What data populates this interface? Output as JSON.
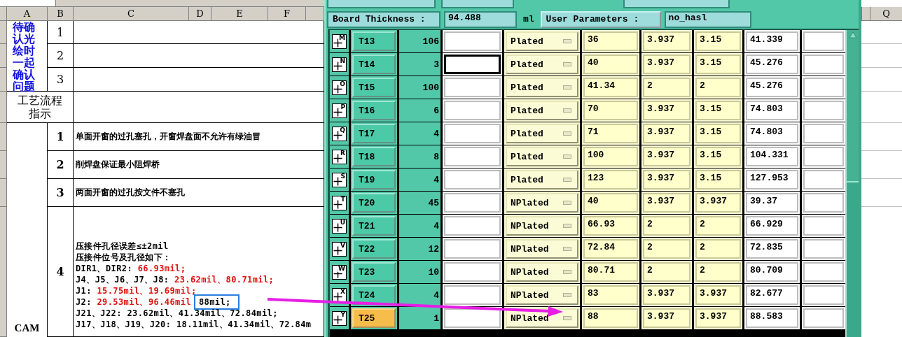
{
  "spreadsheet": {
    "columns": [
      "A",
      "B",
      "C",
      "D",
      "E",
      "F"
    ],
    "pending_label": "待确认光绘时一起确认问题",
    "pending_rows": [
      "1",
      "2",
      "3"
    ],
    "process_label": "工艺流程指示",
    "cam_label": "CAM",
    "process_rows": [
      {
        "number": "1",
        "text": "单面开窗的过孔塞孔，开窗焊盘面不允许有绿油冒"
      },
      {
        "number": "2",
        "text": "削焊盘保证最小阻焊桥"
      },
      {
        "number": "3",
        "text": "两面开窗的过孔按文件不塞孔"
      },
      {
        "number": "4",
        "lines": [
          [
            {
              "text": "压接件孔径误差≤±2mil",
              "emphasis": false,
              "boxed": false
            }
          ],
          [
            {
              "text": "压接件位号及孔径如下：",
              "emphasis": false,
              "boxed": false
            }
          ],
          [
            {
              "text": "DIR1、DIR2: ",
              "emphasis": false,
              "boxed": false
            },
            {
              "text": "66.93mil;",
              "emphasis": true,
              "boxed": false
            }
          ],
          [
            {
              "text": "J4、J5、J6、J7、J8: ",
              "emphasis": false,
              "boxed": false
            },
            {
              "text": "23.62mil、80.71mil;",
              "emphasis": true,
              "boxed": false
            }
          ],
          [
            {
              "text": "J1: ",
              "emphasis": false,
              "boxed": false
            },
            {
              "text": "15.75mil、19.69mil;",
              "emphasis": true,
              "boxed": false
            }
          ],
          [
            {
              "text": "J2: ",
              "emphasis": false,
              "boxed": false
            },
            {
              "text": "29.53mil、96.46mil",
              "emphasis": true,
              "boxed": false
            },
            {
              "text": "88mil;",
              "emphasis": false,
              "boxed": true
            }
          ],
          [
            {
              "text": "J21、J22: 23.62mil、41.34mil、72.84mil;",
              "emphasis": false,
              "boxed": false
            }
          ],
          [
            {
              "text": "J17、J18、J19、J20: 18.11mil、41.34mil、72.84m",
              "emphasis": false,
              "boxed": false
            }
          ]
        ]
      }
    ]
  },
  "cam_dialog": {
    "board_thickness": {
      "label": "Board Thickness :",
      "value": "94.488",
      "unit": "ml"
    },
    "user_parameters": {
      "label": "User Parameters :",
      "value": "no_hasl"
    },
    "tools": [
      {
        "key": "M",
        "name": "T13",
        "count": "106",
        "type": "Plated",
        "value_1": "36",
        "value_2": "3.937",
        "value_3": "3.15",
        "value_4": "41.339",
        "focused": false,
        "selected": false
      },
      {
        "key": "N",
        "name": "T14",
        "count": "3",
        "type": "Plated",
        "value_1": "40",
        "value_2": "3.937",
        "value_3": "3.15",
        "value_4": "45.276",
        "focused": true,
        "selected": false
      },
      {
        "key": "O",
        "name": "T15",
        "count": "100",
        "type": "Plated",
        "value_1": "41.34",
        "value_2": "2",
        "value_3": "2",
        "value_4": "45.276",
        "focused": false,
        "selected": false
      },
      {
        "key": "P",
        "name": "T16",
        "count": "6",
        "type": "Plated",
        "value_1": "70",
        "value_2": "3.937",
        "value_3": "3.15",
        "value_4": "74.803",
        "focused": false,
        "selected": false
      },
      {
        "key": "Q",
        "name": "T17",
        "count": "4",
        "type": "Plated",
        "value_1": "71",
        "value_2": "3.937",
        "value_3": "3.15",
        "value_4": "74.803",
        "focused": false,
        "selected": false
      },
      {
        "key": "R",
        "name": "T18",
        "count": "8",
        "type": "Plated",
        "value_1": "100",
        "value_2": "3.937",
        "value_3": "3.15",
        "value_4": "104.331",
        "focused": false,
        "selected": false
      },
      {
        "key": "S",
        "name": "T19",
        "count": "4",
        "type": "Plated",
        "value_1": "123",
        "value_2": "3.937",
        "value_3": "3.15",
        "value_4": "127.953",
        "focused": false,
        "selected": false
      },
      {
        "key": "T",
        "name": "T20",
        "count": "45",
        "type": "NPlated",
        "value_1": "40",
        "value_2": "3.937",
        "value_3": "3.937",
        "value_4": "39.37",
        "focused": false,
        "selected": false
      },
      {
        "key": "U",
        "name": "T21",
        "count": "4",
        "type": "NPlated",
        "value_1": "66.93",
        "value_2": "2",
        "value_3": "2",
        "value_4": "66.929",
        "focused": false,
        "selected": false
      },
      {
        "key": "V",
        "name": "T22",
        "count": "12",
        "type": "NPlated",
        "value_1": "72.84",
        "value_2": "2",
        "value_3": "2",
        "value_4": "72.835",
        "focused": false,
        "selected": false
      },
      {
        "key": "W",
        "name": "T23",
        "count": "10",
        "type": "NPlated",
        "value_1": "80.71",
        "value_2": "2",
        "value_3": "2",
        "value_4": "80.709",
        "focused": false,
        "selected": false
      },
      {
        "key": "X",
        "name": "T24",
        "count": "4",
        "type": "NPlated",
        "value_1": "83",
        "value_2": "3.937",
        "value_3": "3.937",
        "value_4": "82.677",
        "focused": false,
        "selected": false
      },
      {
        "key": "Y",
        "name": "T25",
        "count": "1",
        "type": "NPlated",
        "value_1": "88",
        "value_2": "3.937",
        "value_3": "3.937",
        "value_4": "88.583",
        "focused": false,
        "selected": true
      }
    ]
  },
  "right_sheet": {
    "column": "Q"
  }
}
